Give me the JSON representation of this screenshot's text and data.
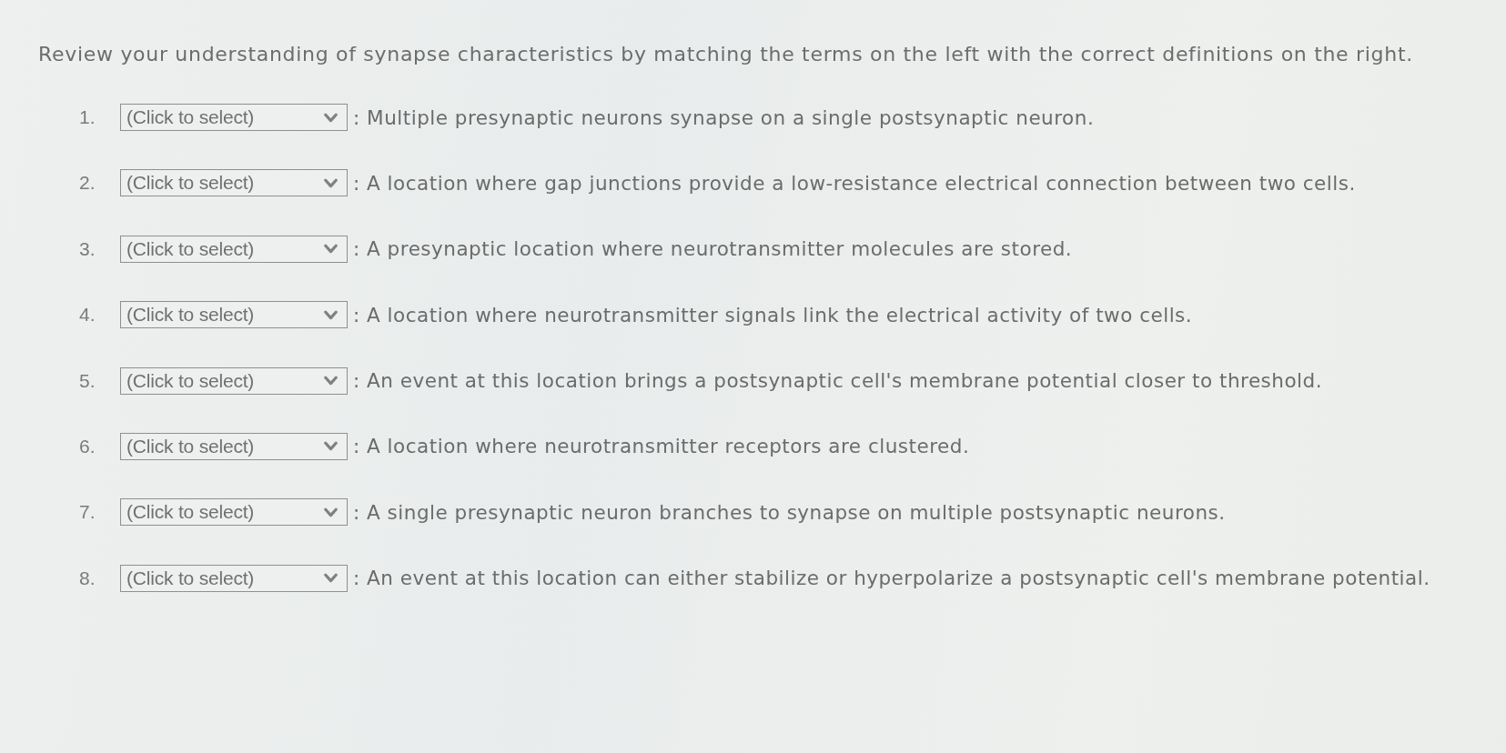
{
  "instruction": "Review your understanding of synapse characteristics by matching the terms on the left with the correct definitions on the right.",
  "items": [
    {
      "number": "1.",
      "selection": "(Click to select)",
      "definition": ": Multiple presynaptic neurons synapse on a single postsynaptic neuron."
    },
    {
      "number": "2.",
      "selection": "(Click to select)",
      "definition": ": A location where gap junctions provide a low-resistance electrical connection between two cells."
    },
    {
      "number": "3.",
      "selection": "(Click to select)",
      "definition": ": A presynaptic location where neurotransmitter molecules are stored."
    },
    {
      "number": "4.",
      "selection": "(Click to select)",
      "definition": ": A location where neurotransmitter signals link the electrical activity of two cells."
    },
    {
      "number": "5.",
      "selection": "(Click to select)",
      "definition": ": An event at this location brings a postsynaptic cell's membrane potential closer to threshold."
    },
    {
      "number": "6.",
      "selection": "(Click to select)",
      "definition": ": A location where neurotransmitter receptors are clustered."
    },
    {
      "number": "7.",
      "selection": "(Click to select)",
      "definition": ": A single presynaptic neuron branches to synapse on multiple postsynaptic neurons."
    },
    {
      "number": "8.",
      "selection": "(Click to select)",
      "definition": ": An event at this location can either stabilize or hyperpolarize a postsynaptic cell's membrane potential."
    }
  ]
}
